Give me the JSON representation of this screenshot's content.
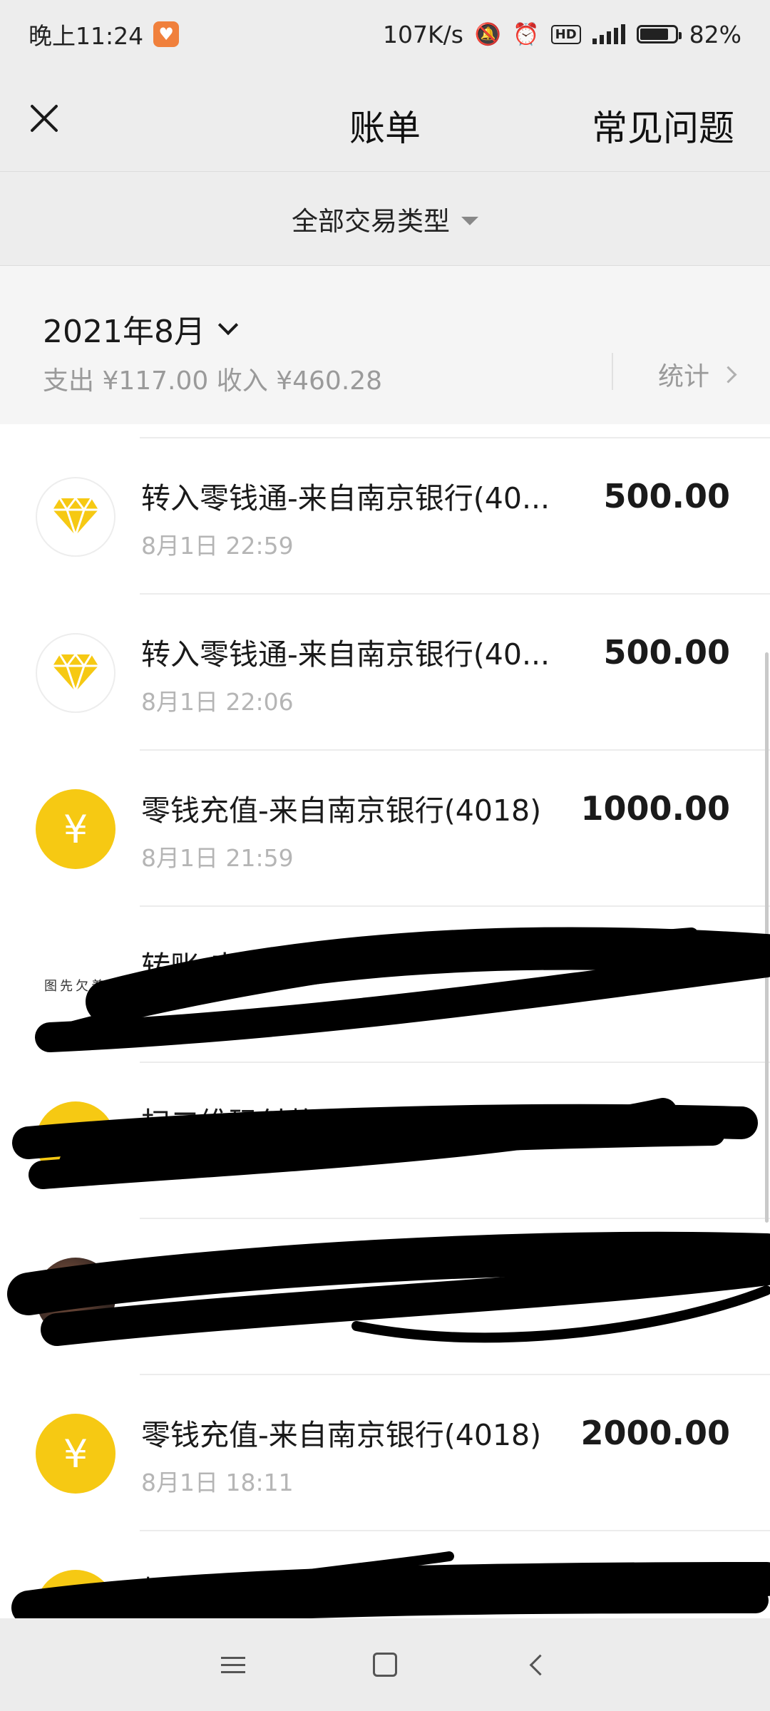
{
  "status_bar": {
    "time": "晚上11:24",
    "net_speed": "107K/s",
    "hd_label": "HD",
    "network": "4G",
    "battery_percent": 82,
    "battery_label": "82%"
  },
  "nav": {
    "title": "账单",
    "faq_label": "常见问题"
  },
  "filter": {
    "label": "全部交易类型"
  },
  "month": {
    "title": "2021年8月",
    "summary": "支出 ¥117.00 收入 ¥460.28",
    "stats_label": "统计"
  },
  "transactions": [
    {
      "title": "转入零钱通-来自南京银行(40...",
      "time": "8月1日 22:59",
      "amount": "500.00",
      "icon": "diamond-icon"
    },
    {
      "title": "转入零钱通-来自南京银行(40...",
      "time": "8月1日 22:06",
      "amount": "500.00",
      "icon": "diamond-icon"
    },
    {
      "title": "零钱充值-来自南京银行(4018)",
      "time": "8月1日 21:59",
      "amount": "1000.00",
      "icon": "yen-icon"
    },
    {
      "title": "转账-来自银行",
      "time": "",
      "amount": "",
      "icon": "placeholder-avatar",
      "avatar_text": "图先欠着",
      "redacted": true
    },
    {
      "title": "扫二维码付款",
      "time": "",
      "amount": "",
      "icon": "avatar",
      "redacted": true
    },
    {
      "title": "扫",
      "time": "",
      "amount": "",
      "icon": "photo-avatar",
      "redacted": true
    },
    {
      "title": "零钱充值-来自南京银行(4018)",
      "time": "8月1日 18:11",
      "amount": "2000.00",
      "icon": "yen-icon"
    },
    {
      "title": "扫",
      "time": "",
      "amount": "",
      "icon": "yen-icon",
      "redacted": true
    }
  ],
  "colors": {
    "header_bg": "#ededed",
    "accent_gold": "#f6c913",
    "amount_orange": "#f3a533"
  }
}
